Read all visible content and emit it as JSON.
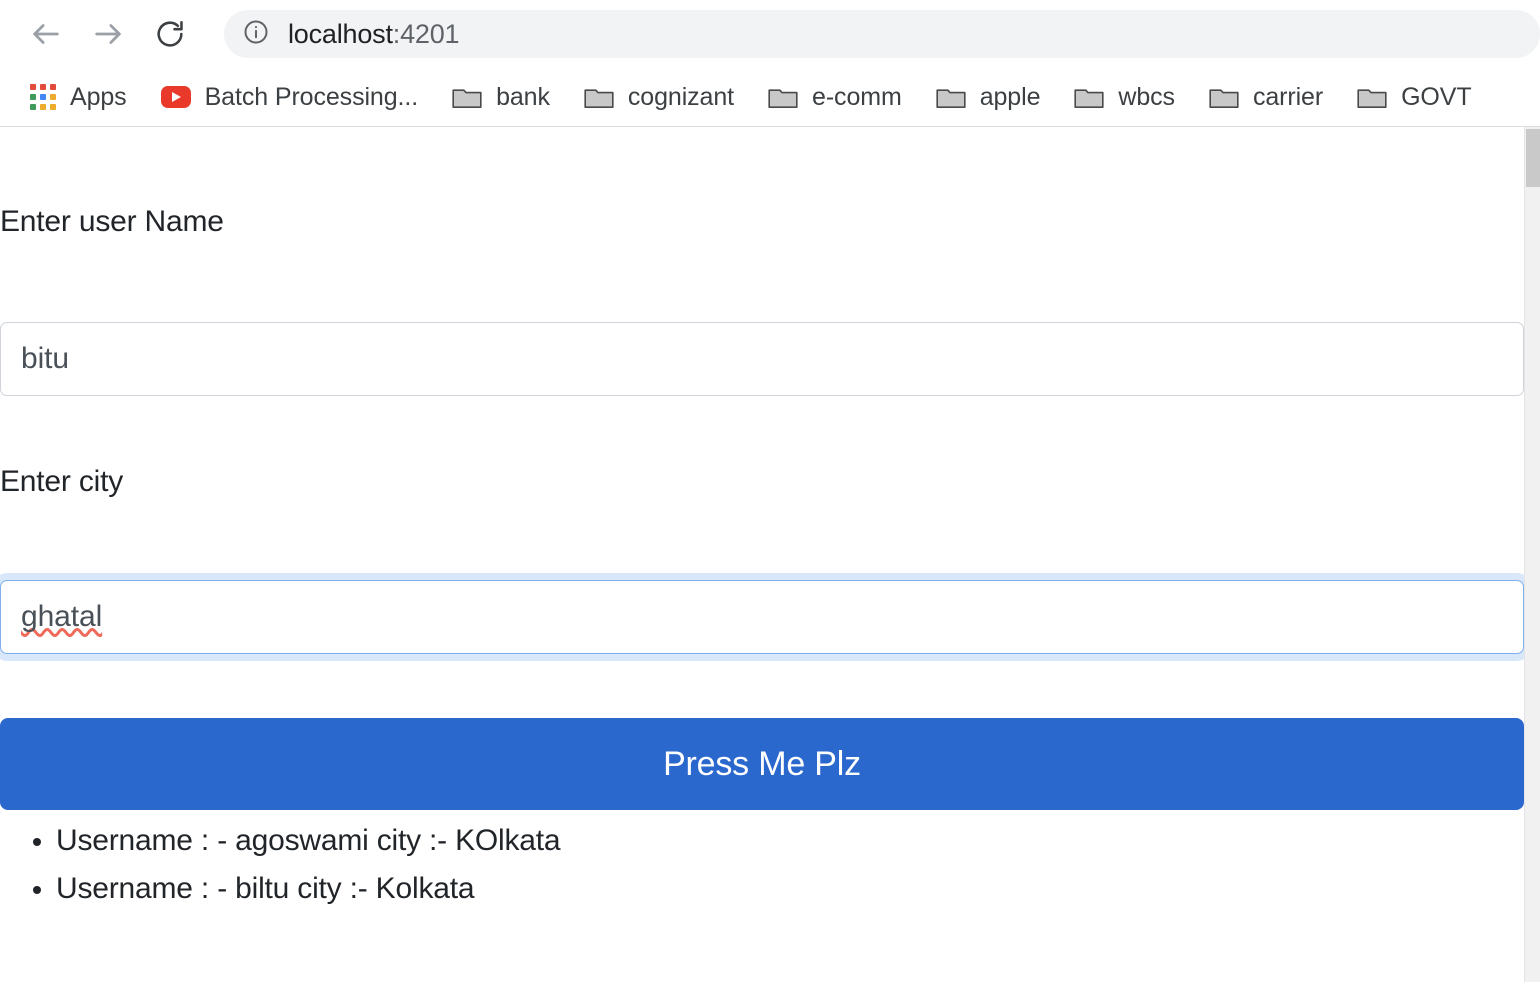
{
  "browser": {
    "nav": {
      "back_label": "Back",
      "forward_label": "Forward",
      "reload_label": "Reload"
    },
    "omnibox": {
      "info_icon": "info-circle-icon",
      "host": "localhost",
      "port": ":4201",
      "full_url": "localhost:4201"
    },
    "bookmarks": [
      {
        "label": "Apps",
        "icon": "apps-grid-icon"
      },
      {
        "label": "Batch Processing...",
        "icon": "youtube-icon"
      },
      {
        "label": "bank",
        "icon": "folder-icon"
      },
      {
        "label": "cognizant",
        "icon": "folder-icon"
      },
      {
        "label": "e-comm",
        "icon": "folder-icon"
      },
      {
        "label": "apple",
        "icon": "folder-icon"
      },
      {
        "label": "wbcs",
        "icon": "folder-icon"
      },
      {
        "label": "carrier",
        "icon": "folder-icon"
      },
      {
        "label": "GOVT",
        "icon": "folder-icon"
      }
    ]
  },
  "page": {
    "username_field": {
      "label": "Enter user Name",
      "value": "bitu",
      "placeholder": "",
      "focused": false
    },
    "city_field": {
      "label": "Enter city",
      "value": "ghatal",
      "placeholder": "",
      "focused": true,
      "spellcheck_error": true
    },
    "submit_button": {
      "label": "Press Me Plz"
    },
    "results": [
      "Username : - agoswami city :- KOlkata",
      "Username : - biltu city :- Kolkata"
    ]
  },
  "colors": {
    "button_blue": "#2a68ce",
    "focus_ring": "#80b0f0",
    "omnibox_bg": "#f1f3f4",
    "spell_underline": "#ef6a5a",
    "text_dark": "#212529"
  },
  "scrollbar": {
    "track_color": "#f1f1f1",
    "thumb_color": "#c9c9c9"
  }
}
